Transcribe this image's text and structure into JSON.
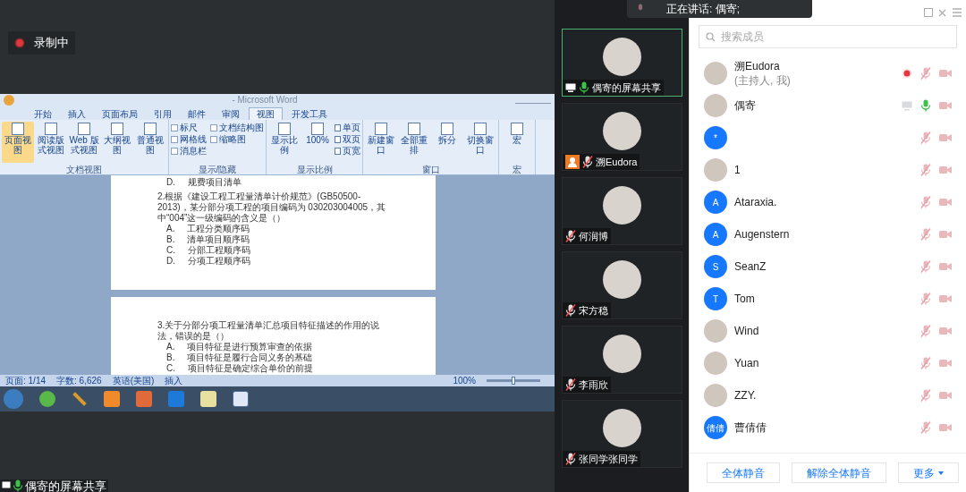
{
  "recording": {
    "label": "录制中"
  },
  "speaking": {
    "text": "正在讲话: 偶寄;"
  },
  "shared_screen": {
    "window_title": "- Microsoft Word",
    "tabs": [
      {
        "label": "开始",
        "selected": false
      },
      {
        "label": "插入",
        "selected": false
      },
      {
        "label": "页面布局",
        "selected": false
      },
      {
        "label": "引用",
        "selected": false
      },
      {
        "label": "邮件",
        "selected": false
      },
      {
        "label": "审阅",
        "selected": false
      },
      {
        "label": "视图",
        "selected": true
      },
      {
        "label": "开发工具",
        "selected": false
      }
    ],
    "ribbon_groups": [
      {
        "label": "文档视图",
        "items": [
          {
            "kind": "button",
            "label": "页面视图",
            "selected": true
          },
          {
            "kind": "button",
            "label": "阅读版式视图",
            "selected": false
          },
          {
            "kind": "button",
            "label": "Web 版式视图",
            "selected": false
          },
          {
            "kind": "button",
            "label": "大纲视图",
            "selected": false
          },
          {
            "kind": "button",
            "label": "普通视图",
            "selected": false
          }
        ]
      },
      {
        "label": "显示/隐藏",
        "items": [
          {
            "kind": "check",
            "label": "标尺",
            "checked": false
          },
          {
            "kind": "check",
            "label": "网格线",
            "checked": false
          },
          {
            "kind": "check",
            "label": "消息栏",
            "checked": false
          },
          {
            "kind": "check",
            "label": "文档结构图",
            "checked": false
          },
          {
            "kind": "check",
            "label": "缩略图",
            "checked": false
          }
        ]
      },
      {
        "label": "显示比例",
        "items": [
          {
            "kind": "button",
            "label": "显示比例",
            "selected": false
          },
          {
            "kind": "button",
            "label": "100%",
            "selected": false
          },
          {
            "kind": "small",
            "label": "单页"
          },
          {
            "kind": "small",
            "label": "双页"
          },
          {
            "kind": "small",
            "label": "页宽"
          }
        ]
      },
      {
        "label": "窗口",
        "items": [
          {
            "kind": "button",
            "label": "新建窗口",
            "selected": false
          },
          {
            "kind": "button",
            "label": "全部重排",
            "selected": false
          },
          {
            "kind": "button",
            "label": "拆分",
            "selected": false
          },
          {
            "kind": "button",
            "label": "切换窗口",
            "selected": false
          }
        ]
      },
      {
        "label": "宏",
        "items": [
          {
            "kind": "button",
            "label": "宏",
            "selected": false
          }
        ]
      }
    ],
    "pages": [
      {
        "lines": [
          {
            "kind": "option",
            "letter": "D.",
            "text": "规费项目清单"
          },
          {
            "kind": "question",
            "text": "2.根据《建设工程工程量清单计价规范》(GB50500-2013)，某分部分项工程的项目编码为 030203004005，其中“004”这一级编码的含义是（）"
          },
          {
            "kind": "option",
            "letter": "A.",
            "text": "工程分类顺序码"
          },
          {
            "kind": "option",
            "letter": "B.",
            "text": "清单项目顺序码"
          },
          {
            "kind": "option",
            "letter": "C.",
            "text": "分部工程顺序码"
          },
          {
            "kind": "option",
            "letter": "D.",
            "text": "分项工程顺序码"
          }
        ]
      },
      {
        "lines": [
          {
            "kind": "question",
            "text": "3.关于分部分项工程量清单汇总项目特征描述的作用的说法，错误的是（）"
          },
          {
            "kind": "option",
            "letter": "A.",
            "text": "项目特征是进行预算审查的依据"
          },
          {
            "kind": "option",
            "letter": "B.",
            "text": "项目特征是履行合同义务的基础"
          },
          {
            "kind": "option",
            "letter": "C.",
            "text": "项目特征是确定综合单价的前提"
          }
        ]
      }
    ],
    "status_bar": [
      "页面: 1/14",
      "字数: 6,626",
      "英语(美国)",
      "插入"
    ],
    "zoom_label": "100%",
    "zoom_slider": {
      "level": 0.5
    }
  },
  "share_label": "偶寄的屏幕共享",
  "video_tiles": [
    {
      "name": "偶寄的屏幕共享",
      "selected": true,
      "muted": false,
      "sharing": true,
      "is_me": false
    },
    {
      "name": "溯Eudora",
      "selected": false,
      "muted": true,
      "sharing": false,
      "is_me": true
    },
    {
      "name": "何润博",
      "selected": false,
      "muted": true,
      "sharing": false,
      "is_me": false
    },
    {
      "name": "宋方稳",
      "selected": false,
      "muted": true,
      "sharing": false,
      "is_me": false
    },
    {
      "name": "李雨欣",
      "selected": false,
      "muted": true,
      "sharing": false,
      "is_me": false
    },
    {
      "name": "张同学张同学",
      "selected": false,
      "muted": true,
      "sharing": false,
      "is_me": false
    }
  ],
  "members": {
    "search": {
      "placeholder": "搜索成员"
    },
    "list": [
      {
        "name": "溯Eudora",
        "subtitle": "(主持人, 我)",
        "kind": "photo",
        "recording": true,
        "sharing": false,
        "muted": true
      },
      {
        "name": "偶寄",
        "kind": "photo",
        "recording": false,
        "sharing": true,
        "muted": false
      },
      {
        "kind": "letter",
        "letter": "*",
        "recording": false,
        "sharing": false,
        "muted": true
      },
      {
        "name": "1",
        "kind": "photo",
        "recording": false,
        "sharing": false,
        "muted": true
      },
      {
        "name": "Ataraxia.",
        "kind": "letter",
        "letter": "A",
        "recording": false,
        "sharing": false,
        "muted": true
      },
      {
        "name": "Augenstern",
        "kind": "letter",
        "letter": "A",
        "recording": false,
        "sharing": false,
        "muted": true
      },
      {
        "name": "SeanZ",
        "kind": "letter",
        "letter": "S",
        "recording": false,
        "sharing": false,
        "muted": true
      },
      {
        "name": "Tom",
        "kind": "letter",
        "letter": "T",
        "recording": false,
        "sharing": false,
        "muted": true
      },
      {
        "name": "Wind",
        "kind": "photo",
        "recording": false,
        "sharing": false,
        "muted": true
      },
      {
        "name": "Yuan",
        "kind": "photo",
        "recording": false,
        "sharing": false,
        "muted": true
      },
      {
        "name": "ZZY.",
        "kind": "photo",
        "recording": false,
        "sharing": false,
        "muted": true
      },
      {
        "name": "曹倩倩",
        "kind": "letter",
        "letter": "倩倩",
        "recording": false,
        "sharing": false,
        "muted": true
      }
    ],
    "buttons": [
      "全体静音",
      "解除全体静音",
      "更多"
    ]
  }
}
